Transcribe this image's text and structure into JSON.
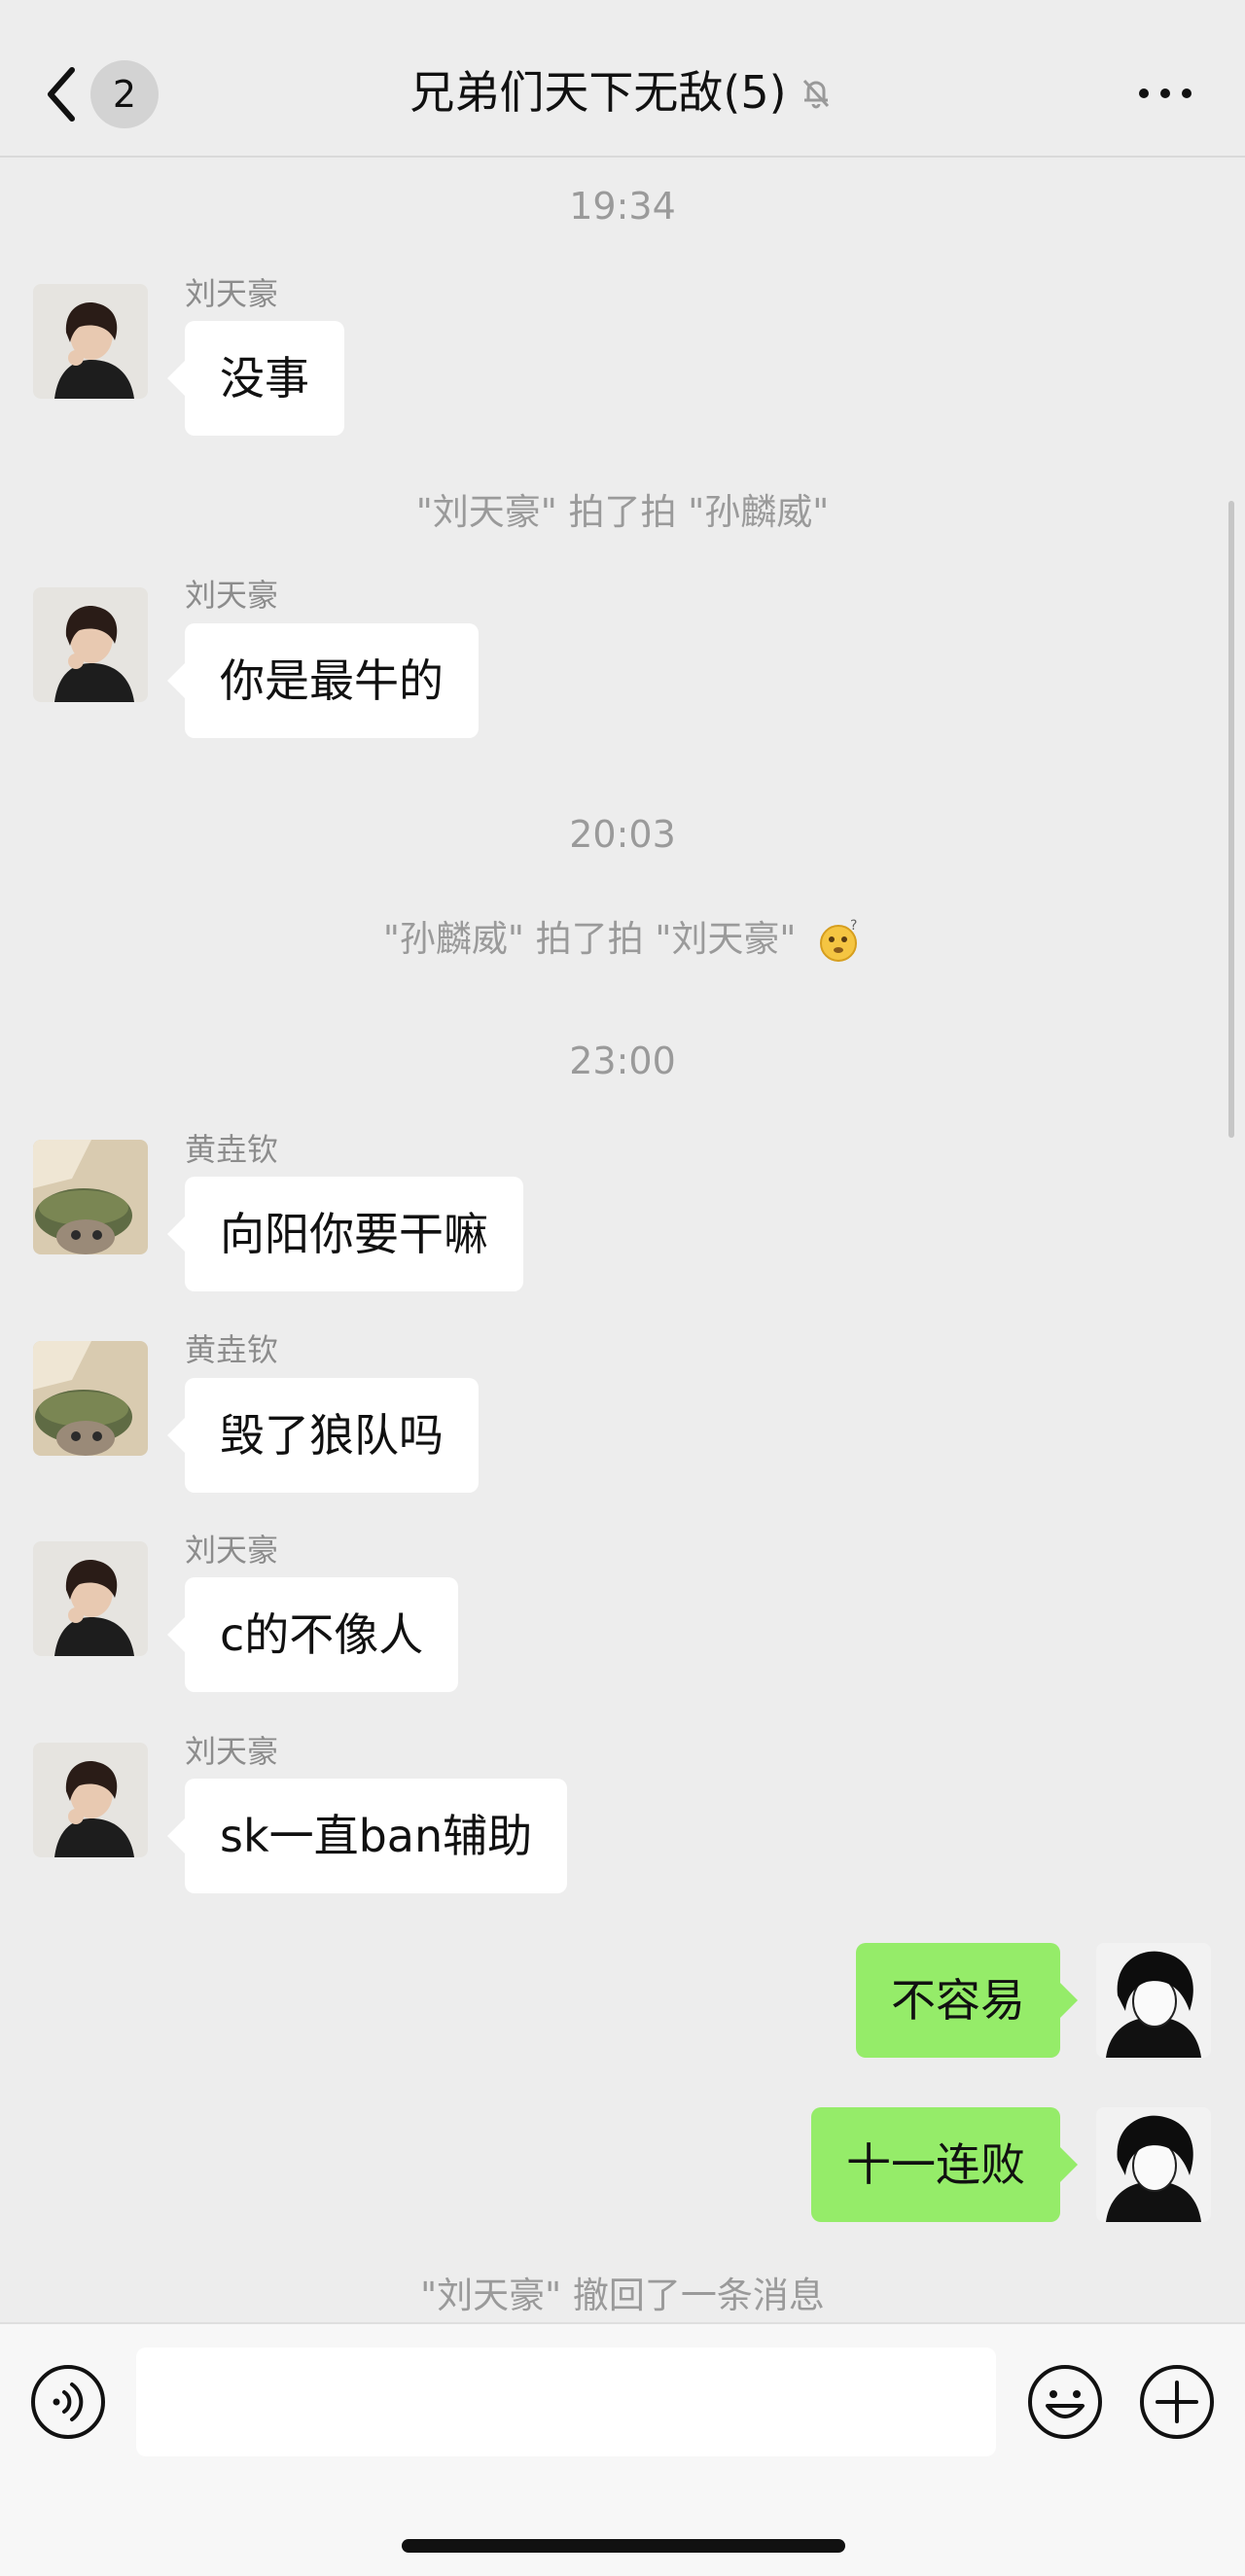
{
  "header": {
    "unread_count": "2",
    "title": "兄弟们天下无敌(5)"
  },
  "messages": [
    {
      "type": "time",
      "text": "19:34"
    },
    {
      "type": "in",
      "sender": "刘天豪",
      "text": "没事",
      "avatar": "liu-avatar"
    },
    {
      "type": "system",
      "text": "\"刘天豪\" 拍了拍 \"孙麟威\""
    },
    {
      "type": "in",
      "sender": "刘天豪",
      "text": "你是最牛的",
      "avatar": "liu-avatar"
    },
    {
      "type": "time",
      "text": "20:03"
    },
    {
      "type": "system",
      "text": "\"孙麟威\" 拍了拍 \"刘天豪\"",
      "icon": "thinking-emoji-icon"
    },
    {
      "type": "time",
      "text": "23:00"
    },
    {
      "type": "in",
      "sender": "黄垚钦",
      "text": "向阳你要干嘛",
      "avatar": "huang-avatar"
    },
    {
      "type": "in",
      "sender": "黄垚钦",
      "text": "毁了狼队吗",
      "avatar": "huang-avatar"
    },
    {
      "type": "in",
      "sender": "刘天豪",
      "text": "c的不像人",
      "avatar": "liu-avatar"
    },
    {
      "type": "in",
      "sender": "刘天豪",
      "text": "sk一直ban辅助",
      "avatar": "liu-avatar"
    },
    {
      "type": "out",
      "text": "不容易",
      "avatar": "self-avatar"
    },
    {
      "type": "out",
      "text": "十一连败",
      "avatar": "self-avatar"
    },
    {
      "type": "system",
      "text": "\"刘天豪\" 撤回了一条消息"
    }
  ],
  "footer": {
    "input_value": ""
  },
  "colors": {
    "background": "#ededed",
    "bubble_in": "#ffffff",
    "bubble_out": "#95ec69",
    "system_text": "#9a9a9a"
  }
}
